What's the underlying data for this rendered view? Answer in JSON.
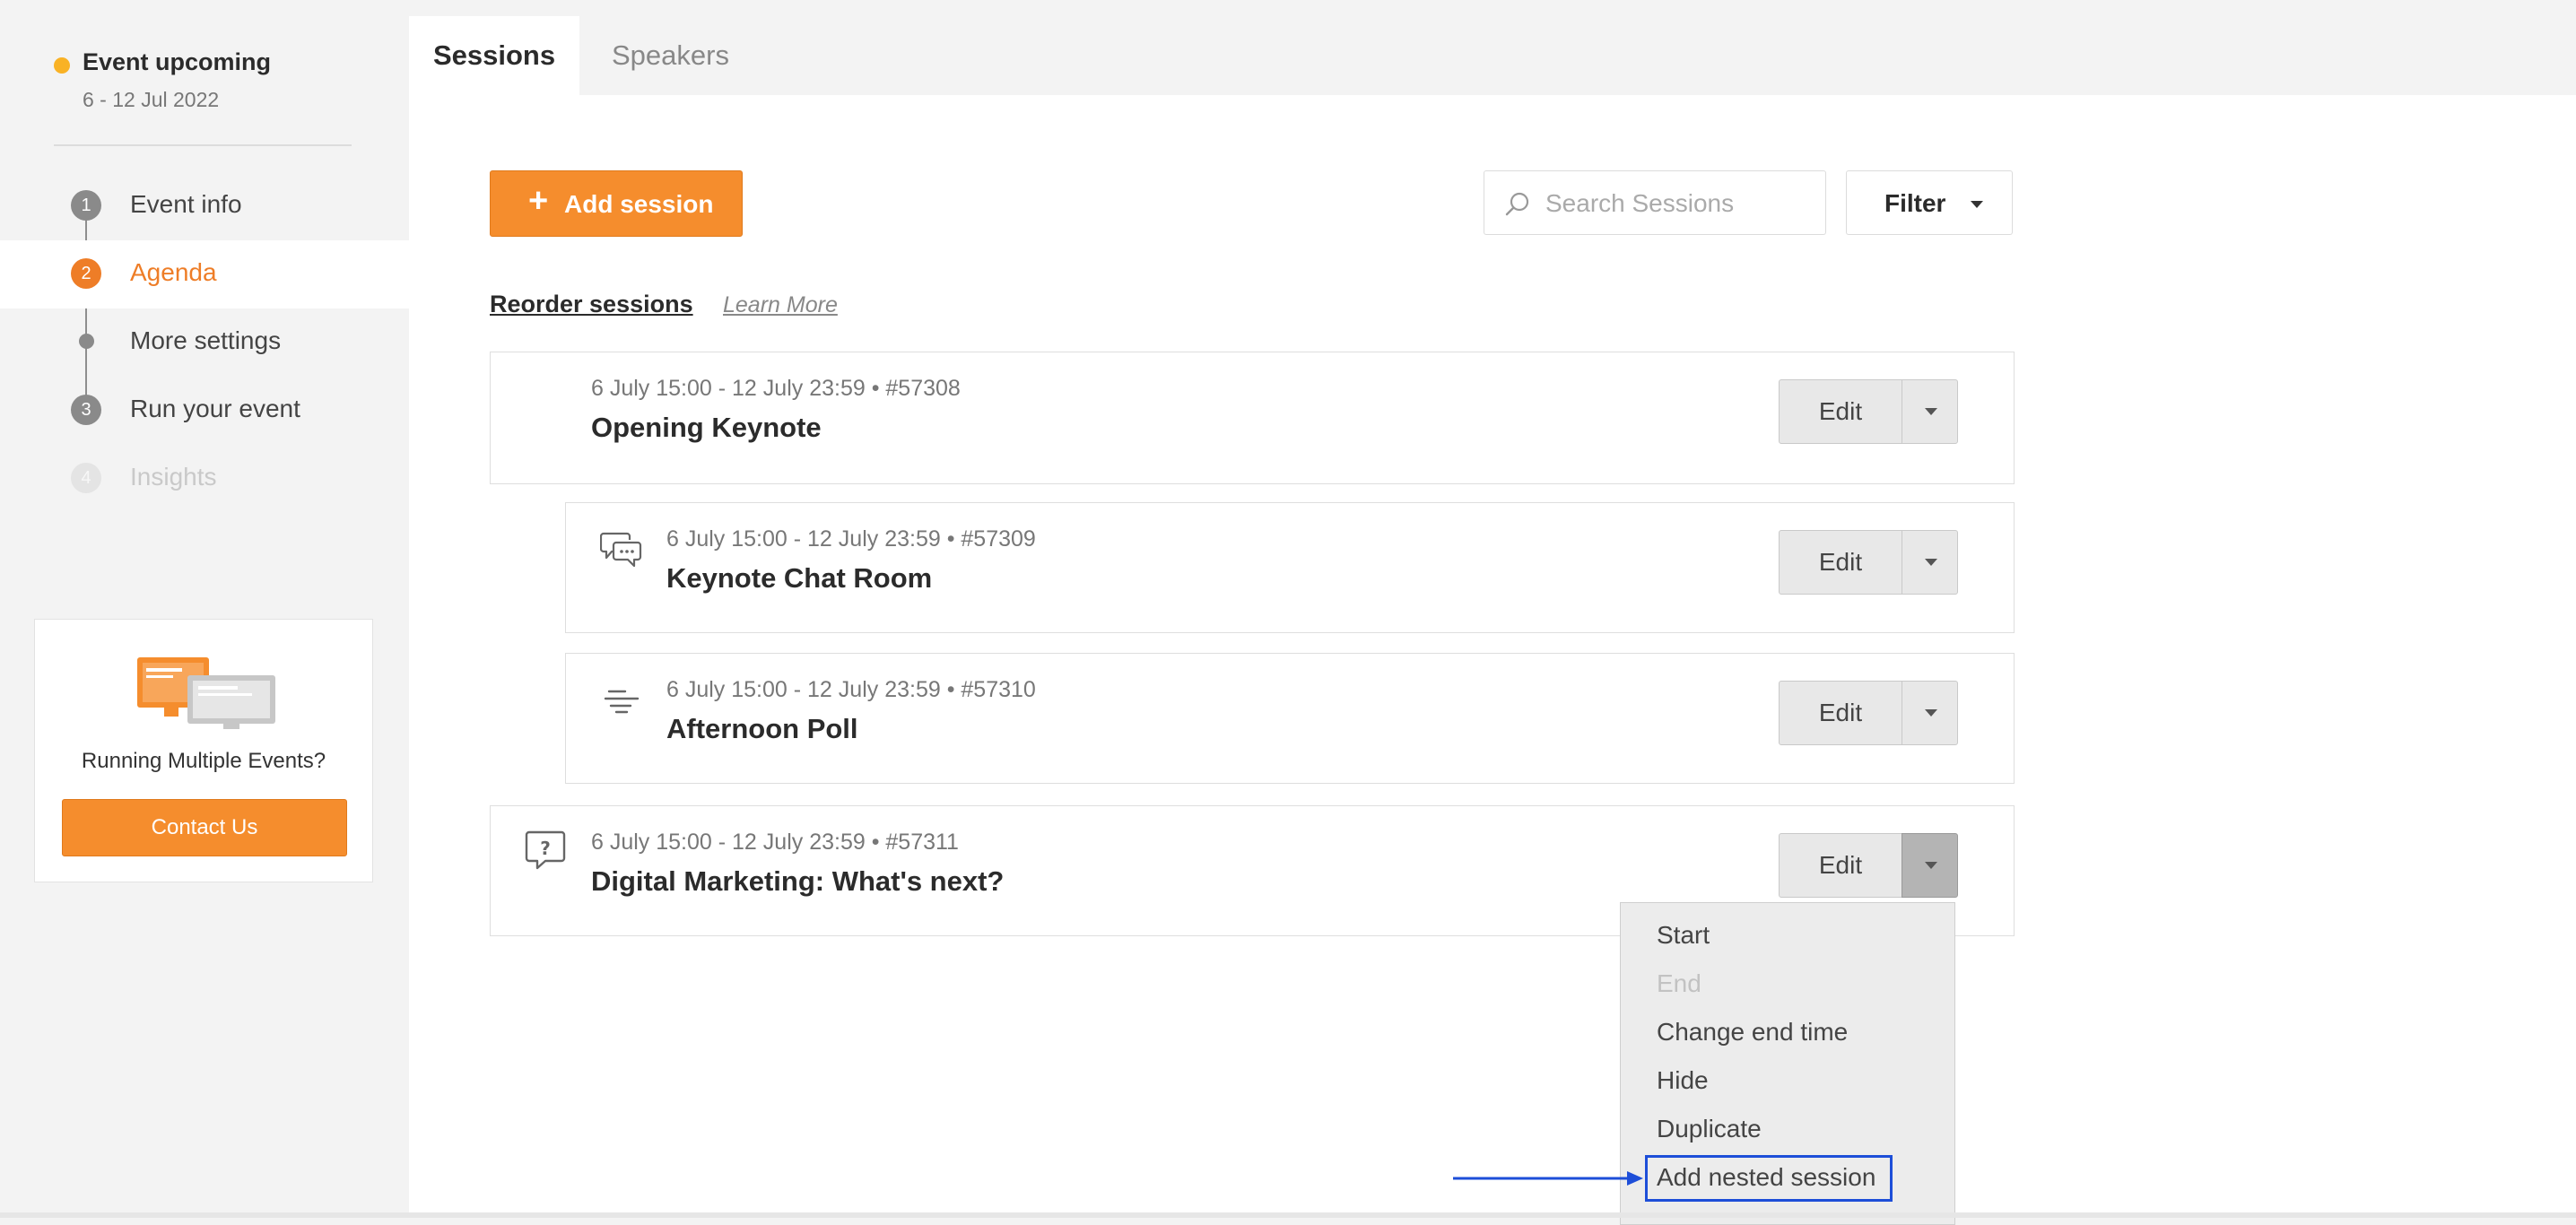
{
  "status": {
    "title": "Event upcoming",
    "dates": "6 - 12 Jul 2022",
    "color": "#f9b225"
  },
  "steps": [
    {
      "num": "1",
      "label": "Event info"
    },
    {
      "num": "2",
      "label": "Agenda"
    },
    {
      "num": "",
      "label": "More settings"
    },
    {
      "num": "3",
      "label": "Run your event"
    },
    {
      "num": "4",
      "label": "Insights"
    }
  ],
  "promo": {
    "text": "Running Multiple Events?",
    "button": "Contact Us"
  },
  "tabs": [
    {
      "label": "Sessions"
    },
    {
      "label": "Speakers"
    }
  ],
  "toolbar": {
    "add_label": "Add session",
    "search_placeholder": "Search Sessions",
    "filter_label": "Filter"
  },
  "reorder": {
    "label": "Reorder sessions",
    "learn_more": "Learn More"
  },
  "sessions": [
    {
      "meta": "6 July 15:00 - 12 July 23:59  •  #57308",
      "title": "Opening Keynote",
      "icon": "none",
      "edit_label": "Edit"
    },
    {
      "meta": "6 July 15:00 - 12 July 23:59  •  #57309",
      "title": "Keynote Chat Room",
      "icon": "chat-bubbles-icon",
      "edit_label": "Edit"
    },
    {
      "meta": "6 July 15:00 - 12 July 23:59  •  #57310",
      "title": "Afternoon Poll",
      "icon": "poll-icon",
      "edit_label": "Edit"
    },
    {
      "meta": "6 July 15:00 - 12 July 23:59  •  #57311",
      "title": "Digital Marketing: What's next?",
      "icon": "question-bubble-icon",
      "edit_label": "Edit"
    }
  ],
  "menu": [
    {
      "label": "Start",
      "enabled": true
    },
    {
      "label": "End",
      "enabled": false
    },
    {
      "label": "Change end time",
      "enabled": true
    },
    {
      "label": "Hide",
      "enabled": true
    },
    {
      "label": "Duplicate",
      "enabled": true
    },
    {
      "label": "Add nested session",
      "enabled": true,
      "highlighted": true
    }
  ],
  "colors": {
    "accent": "#f58d2d",
    "active_text": "#ee7d27",
    "highlight": "#1d4ed8"
  }
}
